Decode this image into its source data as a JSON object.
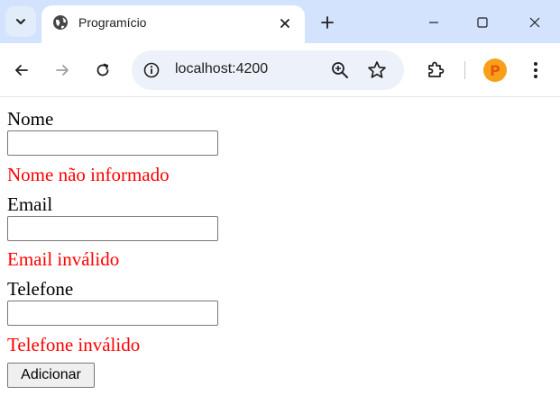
{
  "browser": {
    "tab": {
      "title": "Programício"
    },
    "address": {
      "url": "localhost:4200"
    },
    "profile": {
      "initial": "P"
    },
    "colors": {
      "tabstrip": "#d3e3fd",
      "omnibox": "#edf2fa",
      "profile": "#f8a01a"
    }
  },
  "form": {
    "nome": {
      "label": "Nome",
      "value": "",
      "error": "Nome não informado"
    },
    "email": {
      "label": "Email",
      "value": "",
      "error": "Email inválido"
    },
    "telefone": {
      "label": "Telefone",
      "value": "",
      "error": "Telefone inválido"
    },
    "submit_label": "Adicionar",
    "colors": {
      "error": "#ff0000"
    }
  }
}
